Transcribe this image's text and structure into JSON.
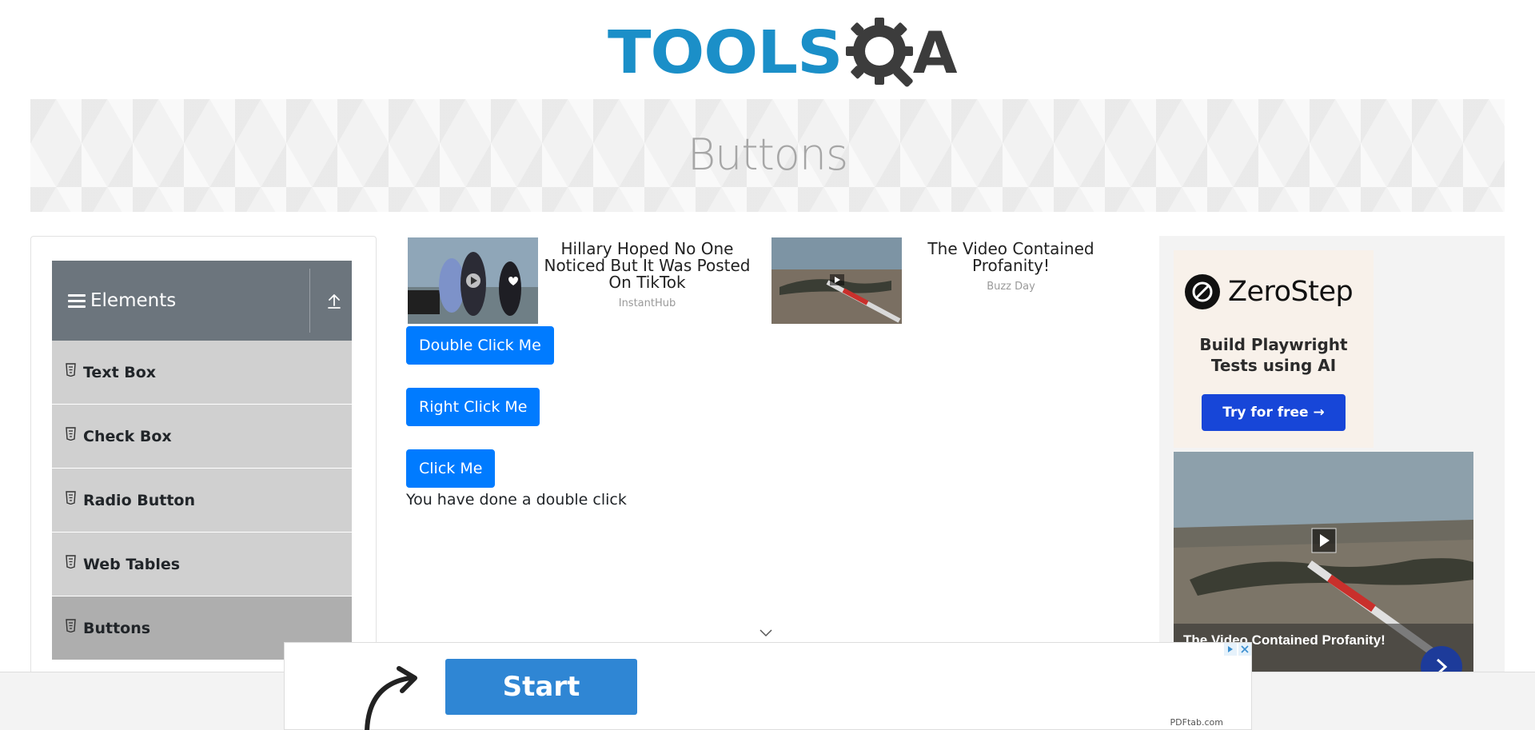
{
  "header": {
    "logo_text_tools": "TOOLS",
    "logo_text_a": "A",
    "brand_blue": "#1b8fc8",
    "brand_dark": "#3c3c3c"
  },
  "banner": {
    "title": "Buttons"
  },
  "sidebar": {
    "group_title": "Elements",
    "items": [
      {
        "label": "Text Box",
        "icon": "html5-file-icon"
      },
      {
        "label": "Check Box",
        "icon": "html5-file-icon"
      },
      {
        "label": "Radio Button",
        "icon": "html5-file-icon"
      },
      {
        "label": "Web Tables",
        "icon": "html5-file-icon"
      },
      {
        "label": "Buttons",
        "icon": "html5-file-icon",
        "active": true
      }
    ]
  },
  "ads_top": [
    {
      "headline": "Hillary Hoped No One Noticed But It Was Posted On TikTok",
      "source": "InstantHub"
    },
    {
      "headline": "The Video Contained Profanity!",
      "source": "Buzz Day"
    }
  ],
  "buttons": {
    "double_click": "Double Click Me",
    "right_click": "Right Click Me",
    "click": "Click Me",
    "accent": "#007bff"
  },
  "result_message": "You have done a double click",
  "right_ad": {
    "brand": "ZeroStep",
    "tagline_line1": "Build Playwright",
    "tagline_line2": "Tests using AI",
    "cta": "Try for free →",
    "video_caption": "The Video Contained Profanity!"
  },
  "bottom_ad": {
    "cta": "Start",
    "source": "PDFtab.com"
  }
}
